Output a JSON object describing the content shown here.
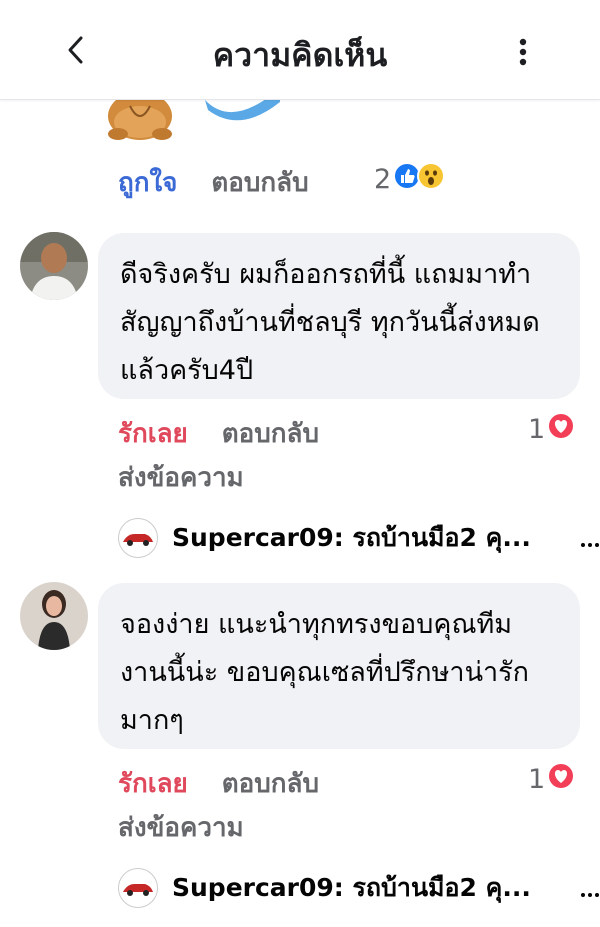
{
  "header": {
    "title": "ความคิดเห็น"
  },
  "top_comment": {
    "like_label": "ถูกใจ",
    "reply_label": "ตอบกลับ",
    "reaction_count": "2"
  },
  "comments": [
    {
      "text": "ดีจริงครับ ผมก็ออกรถที่นี้ แถมมาทำสัญญาถึงบ้านที่ชลบุรี ทุกวันนี้ส่งหมดแล้วครับ4ปี",
      "like_label": "รักเลย",
      "reply_label": "ตอบกลับ",
      "send_label": "ส่งข้อความ",
      "reaction_count": "1",
      "reply_preview": "Supercar09: รถบ้านมือ2 คุ..."
    },
    {
      "text": "จองง่าย แนะนำทุกทรงขอบคุณทีมงานนี้น่ะ ขอบคุณเซลที่ปรึกษาน่ารักมากๆ",
      "like_label": "รักเลย",
      "reply_label": "ตอบกลับ",
      "send_label": "ส่งข้อความ",
      "reaction_count": "1",
      "reply_preview": "Supercar09: รถบ้านมือ2 คุ..."
    }
  ],
  "colors": {
    "like_blue": "#3b6ad6",
    "love_red": "#e0485c",
    "bubble": "#f0f2f5",
    "muted_text": "#65676b"
  }
}
